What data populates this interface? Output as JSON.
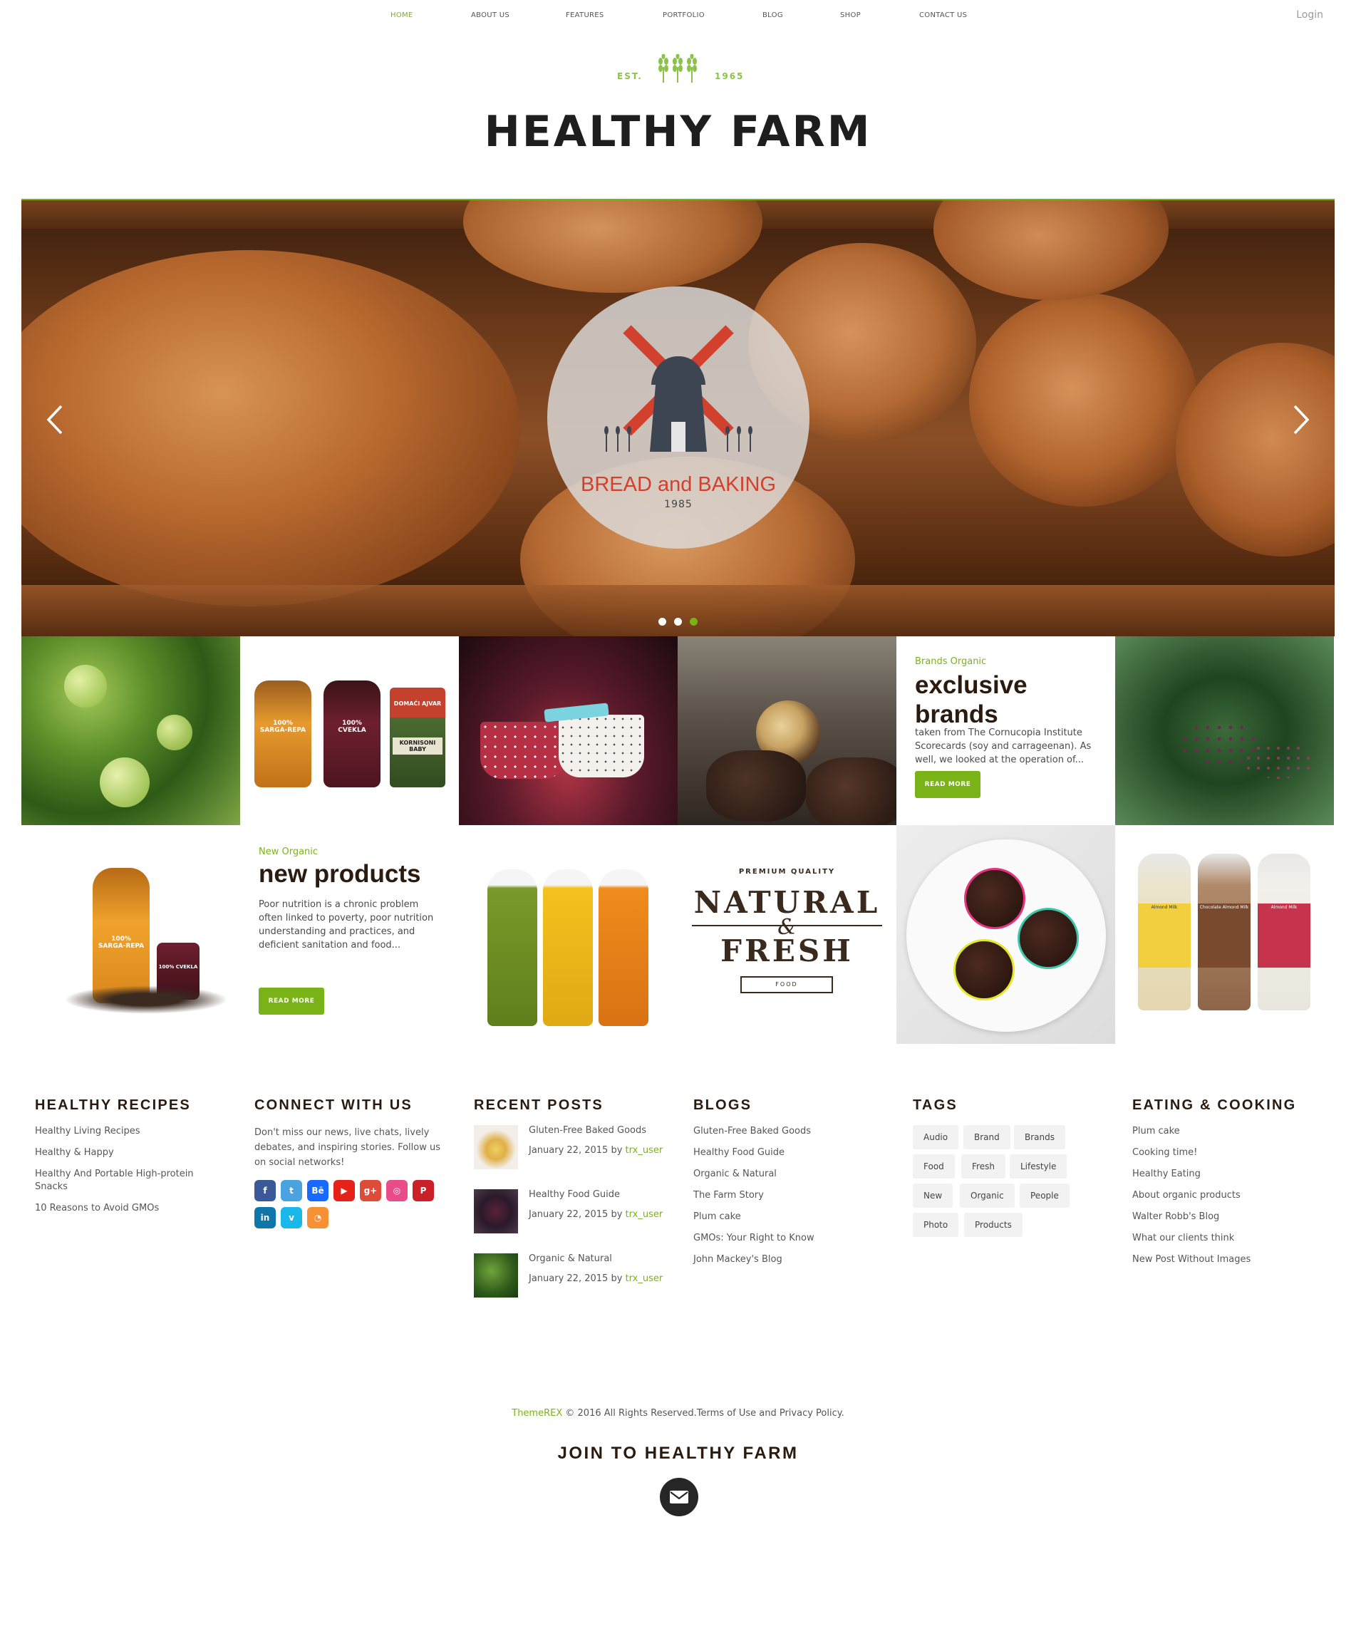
{
  "nav": {
    "items": [
      "HOME",
      "ABOUT US",
      "FEATURES",
      "PORTFOLIO",
      "BLOG",
      "SHOP",
      "CONTACT US"
    ],
    "login": "Login"
  },
  "logo": {
    "est": "EST.",
    "year": "1965",
    "title": "HEALTHY FARM"
  },
  "hero": {
    "badge_name": "BREAD and BAKING",
    "badge_year": "1985",
    "active_slide": 3,
    "slide_count": 3
  },
  "tiles": {
    "exclusive": {
      "kicker": "Brands Organic",
      "heading": "exclusive brands",
      "excerpt": "taken from The Cornucopia Institute Scorecards (soy and carrageenan). As well, we looked at the operation of...",
      "button": "READ MORE"
    },
    "new_products": {
      "kicker": "New Organic",
      "heading": "new products",
      "excerpt": "Poor nutrition is a chronic problem often linked to poverty, poor nutrition understanding and practices, and deficient sanitation and food...",
      "button": "READ MORE"
    },
    "jars": [
      "100% SARGA-REPA",
      "100% CVEKLA",
      "DOMAĆI AJVAR",
      "KORNISONI BABY"
    ],
    "product_bottle": [
      "100% SARGA-REPA",
      "100% CVEKLA"
    ],
    "natural_fresh": {
      "premium": "PREMIUM QUALITY",
      "line1": "NATURAL",
      "amp": "&",
      "line2": "FRESH",
      "food": "FOOD"
    },
    "bottle_labels": [
      "Almond Milk",
      "Chocolate Almond Milk",
      "Almond Milk"
    ]
  },
  "widgets": {
    "recipes": {
      "title": "HEALTHY RECIPES",
      "items": [
        "Healthy Living Recipes",
        "Healthy & Happy",
        "Healthy And Portable High-protein Snacks",
        "10 Reasons to Avoid GMOs"
      ]
    },
    "connect": {
      "title": "CONNECT WITH US",
      "text": "Don't miss our news, live chats, lively debates, and inspiring stories. Follow us on social networks!",
      "icons": [
        "facebook-icon",
        "twitter-icon",
        "behance-icon",
        "youtube-icon",
        "google-plus-icon",
        "dribbble-icon",
        "pinterest-icon",
        "linkedin-icon",
        "vimeo-icon",
        "rss-icon"
      ],
      "icon_glyphs": [
        "f",
        "t",
        "Bē",
        "▶",
        "g+",
        "◎",
        "P",
        "in",
        "v",
        "◔"
      ],
      "colors": [
        "#3b5998",
        "#4aa3df",
        "#1769ff",
        "#e62117",
        "#dd4b39",
        "#ea4c89",
        "#cb2027",
        "#0e76a8",
        "#1ab7ea",
        "#f89034"
      ]
    },
    "posts": {
      "title": "RECENT POSTS",
      "items": [
        {
          "title": "Gluten-Free Baked Goods",
          "date": "January 22, 2015",
          "by": "by",
          "author": "trx_user"
        },
        {
          "title": "Healthy Food Guide",
          "date": "January 22, 2015",
          "by": "by",
          "author": "trx_user"
        },
        {
          "title": "Organic & Natural",
          "date": "January 22, 2015",
          "by": "by",
          "author": "trx_user"
        }
      ]
    },
    "blogs": {
      "title": "BLOGS",
      "items": [
        "Gluten-Free Baked Goods",
        "Healthy Food Guide",
        "Organic & Natural",
        "The Farm Story",
        "Plum cake",
        "GMOs: Your Right to Know",
        "John Mackey's Blog"
      ]
    },
    "tags": {
      "title": "TAGS",
      "items": [
        "Audio",
        "Brand",
        "Brands",
        "Food",
        "Fresh",
        "Lifestyle",
        "New",
        "Organic",
        "People",
        "Photo",
        "Products"
      ]
    },
    "eating": {
      "title": "EATING & COOKING",
      "items": [
        "Plum cake",
        "Cooking time!",
        "Healthy Eating",
        "About organic products",
        "Walter Robb's Blog",
        "What our clients think",
        "New Post Without Images"
      ]
    }
  },
  "footer": {
    "brand": "ThemeREX",
    "copyright": "© 2016 All Rights Reserved.",
    "terms": "Terms of Use and Privacy Policy.",
    "join": "JOIN TO HEALTHY FARM"
  },
  "colors": {
    "accent": "#7ab317",
    "heading": "#2b1a0e"
  }
}
